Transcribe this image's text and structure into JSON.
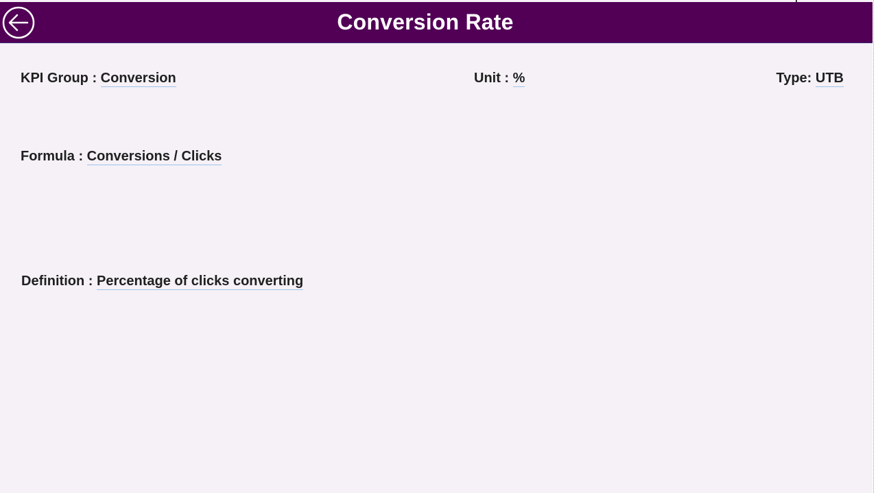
{
  "header": {
    "title": "Conversion Rate",
    "back_icon": "arrow-left-circle-icon",
    "bg_color": "#510055"
  },
  "fields": {
    "kpi_group": {
      "label": "KPI Group : ",
      "value": "Conversion"
    },
    "unit": {
      "label": "Unit : ",
      "value": "%"
    },
    "type": {
      "label": "Type: ",
      "value": "UTB"
    },
    "formula": {
      "label": "Formula : ",
      "value": "Conversions / Clicks"
    },
    "definition": {
      "label": "Definition : ",
      "value": "Percentage of clicks converting"
    }
  },
  "colors": {
    "background": "#f5f1f7",
    "underline": "#9ec3e6",
    "text": "#1f1f1f"
  }
}
